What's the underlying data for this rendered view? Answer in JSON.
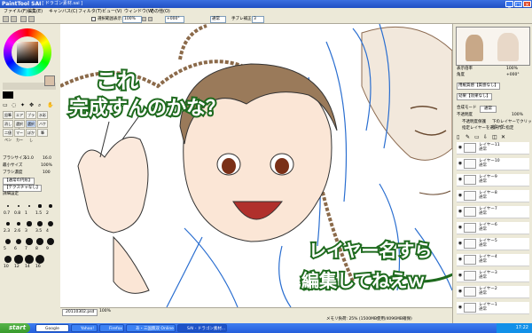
{
  "window": {
    "app_logo": "PaintTool SAI",
    "title": "- [ ドラゴン素材.sai ]"
  },
  "menubar": [
    "ファイル(F)",
    "編集(E)",
    "キャンバス(C)",
    "フィルタ(T)",
    "ビュー(V)",
    "ウィンドウ(W)",
    "その他(O)"
  ],
  "toolbar": {
    "checkbox_label": "選択範囲表示",
    "zoom": "100%",
    "angle": "+000°",
    "mode": "通常",
    "stabilizer_label": "手ブレ補正",
    "stabilizer": "3"
  },
  "tools": {
    "row1": [
      "鉛筆",
      "エアブラシ",
      "ブラシ",
      "水彩"
    ],
    "row2": [
      "消しゴム",
      "選択ペン",
      "選択消し",
      "バケツ"
    ],
    "row3": [
      "二値ペン",
      "マーカー",
      "ぼかし",
      "筆"
    ],
    "brush_size_label": "ブラシサイズ",
    "brush_size": "x1.0",
    "brush_size_value": "16.0",
    "min_size_label": "最小サイズ",
    "min_size_value": "100%",
    "brush_density_label": "ブラシ濃度",
    "brush_density_value": "100",
    "shape_label": "【通常の円形】",
    "texture_label": "【テクスチャなし】",
    "detail_label": "詳細設定",
    "size_values": [
      "0.7",
      "0.8",
      "1",
      "1.5",
      "2",
      "2.3",
      "2.6",
      "3",
      "3.5",
      "4",
      "5",
      "6",
      "7",
      "8",
      "9",
      "10",
      "12",
      "14",
      "16"
    ]
  },
  "canvas_text": {
    "line1": "これ",
    "line2": "完成すんのかな？",
    "line3": "レイヤー名すら",
    "line4": "編集してねえｗ"
  },
  "navigator": {
    "zoom_label": "表示倍率",
    "zoom": "100%",
    "angle_label": "角度",
    "angle": "+000°"
  },
  "layer_panel": {
    "buttons": [
      "用紙質感【質感なし】",
      "効果【効果なし】"
    ],
    "blend_label": "合成モード",
    "blend": "通常",
    "opacity_label": "不透明度",
    "opacity": "100%",
    "protect_label": "不透明度保護",
    "clip_label": "下のレイヤーでクリッピング",
    "select_source": "指定レイヤーを選択元に指定",
    "layers": [
      {
        "name": "レイヤー11",
        "mode": "通常"
      },
      {
        "name": "レイヤー10",
        "mode": "通常"
      },
      {
        "name": "レイヤー9",
        "mode": "通常"
      },
      {
        "name": "レイヤー8",
        "mode": "通常"
      },
      {
        "name": "レイヤー7",
        "mode": "通常"
      },
      {
        "name": "レイヤー6",
        "mode": "通常"
      },
      {
        "name": "レイヤー5",
        "mode": "通常"
      },
      {
        "name": "レイヤー4",
        "mode": "通常"
      },
      {
        "name": "レイヤー3",
        "mode": "通常"
      },
      {
        "name": "レイヤー2",
        "mode": "通常"
      },
      {
        "name": "レイヤー1",
        "mode": "通常"
      }
    ]
  },
  "statusbar": {
    "file_tab": "20110302.psd",
    "file_zoom": "100%",
    "memory": "メモリ負荷: 25% (1500MB使用/4096MB確保)"
  },
  "taskbar": {
    "start": "start",
    "items": [
      "Google",
      "Yahoo!",
      "Firefox",
      "あ・三国無双 Online",
      "SAI - ドラゴン素材..."
    ],
    "clock": "17:22"
  },
  "colors": {
    "title": "#2b5fd6",
    "hand_fill": "#ffffff",
    "hand_stroke": "#1e6a1e",
    "line_art": "#2a6ed0"
  }
}
